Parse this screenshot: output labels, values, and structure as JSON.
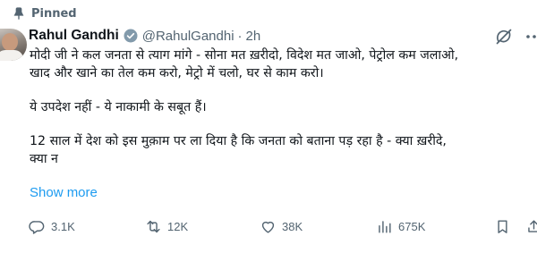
{
  "pinned": {
    "label": "Pinned"
  },
  "author": {
    "name": "Rahul Gandhi",
    "handle": "@RahulGandhi",
    "separator": "·",
    "time": "2h"
  },
  "tweet": {
    "lines": [
      "मोदी जी ने कल जनता से त्याग मांगे - सोना मत ख़रीदो, विदेश मत जाओ, पेट्रोल कम जलाओ,",
      "खाद और खाने का तेल कम करो, मेट्रो में चलो, घर से काम करो।",
      "ये उपदेश नहीं - ये नाकामी के सबूत हैं।",
      "12 साल में देश को इस मुक़ाम पर ला दिया है कि जनता को बताना पड़ रहा है - क्या ख़रीदे,",
      "क्या न"
    ],
    "show_more": "Show more"
  },
  "actions": {
    "replies": "3.1K",
    "reposts": "12K",
    "likes": "38K",
    "views": "675K"
  },
  "icons": [
    "pin-icon",
    "verified-badge-icon",
    "grok-icon",
    "more-icon",
    "reply-icon",
    "repost-icon",
    "like-icon",
    "views-icon",
    "bookmark-icon",
    "share-icon"
  ],
  "colors": {
    "text": "#0f1419",
    "muted": "#536471",
    "accent": "#1d9bf0"
  }
}
